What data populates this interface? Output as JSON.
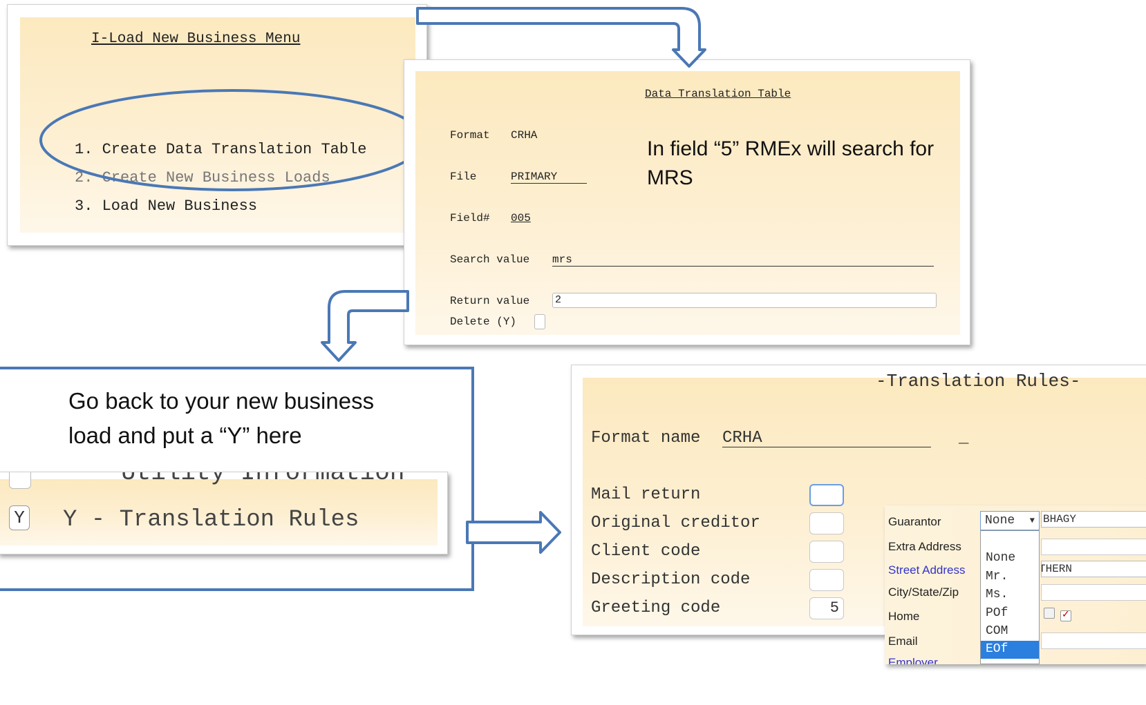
{
  "menu_panel": {
    "title": "I-Load New Business Menu",
    "items": [
      "1. Create Data Translation Table",
      "2. Create New Business Loads",
      "3. Load New Business"
    ]
  },
  "translation_table_panel": {
    "title": "Data Translation Table",
    "format_label": "Format",
    "format_value": "CRHA",
    "file_label": "File",
    "file_value": "PRIMARY",
    "field_label": "Field#",
    "field_value": "005",
    "search_label": "Search value",
    "search_value": "mrs",
    "return_label": "Return value",
    "return_value": "2",
    "delete_label": "Delete (Y)",
    "callout": "In field “5” RMEx will search for MRS"
  },
  "new_business_callout": {
    "text_line1": "Go back to your new business",
    "text_line2": "load and put a “Y” here",
    "field_value": "Y",
    "option_label": "Y - Translation Rules",
    "cut_text": "Utility Information"
  },
  "translation_rules_panel": {
    "title": "-Translation Rules-",
    "format_name_label": "Format name",
    "format_name_value": "CRHA",
    "underscore": "_",
    "rows": [
      {
        "label": "Mail return",
        "value": ""
      },
      {
        "label": "Original creditor",
        "value": ""
      },
      {
        "label": "Client code",
        "value": ""
      },
      {
        "label": "Description code",
        "value": ""
      },
      {
        "label": "Greeting code",
        "value": "5"
      }
    ]
  },
  "guarantor_popup": {
    "labels": [
      "Guarantor",
      "Extra Address",
      "Street Address",
      "City/State/Zip",
      "Home",
      "Email",
      "Employer"
    ],
    "select_value": "None",
    "options": [
      "None",
      "Mr.",
      "Ms.",
      "POf",
      "COM",
      "EOf"
    ],
    "selected_option": "EOf",
    "partial_fields": [
      "BHAGY",
      "THERN"
    ],
    "colors": {
      "link": "#3333cc",
      "selected_bg": "#2a7fdf"
    }
  },
  "colors": {
    "arrow": "#4a78b5",
    "cream": "#fdefd2"
  }
}
